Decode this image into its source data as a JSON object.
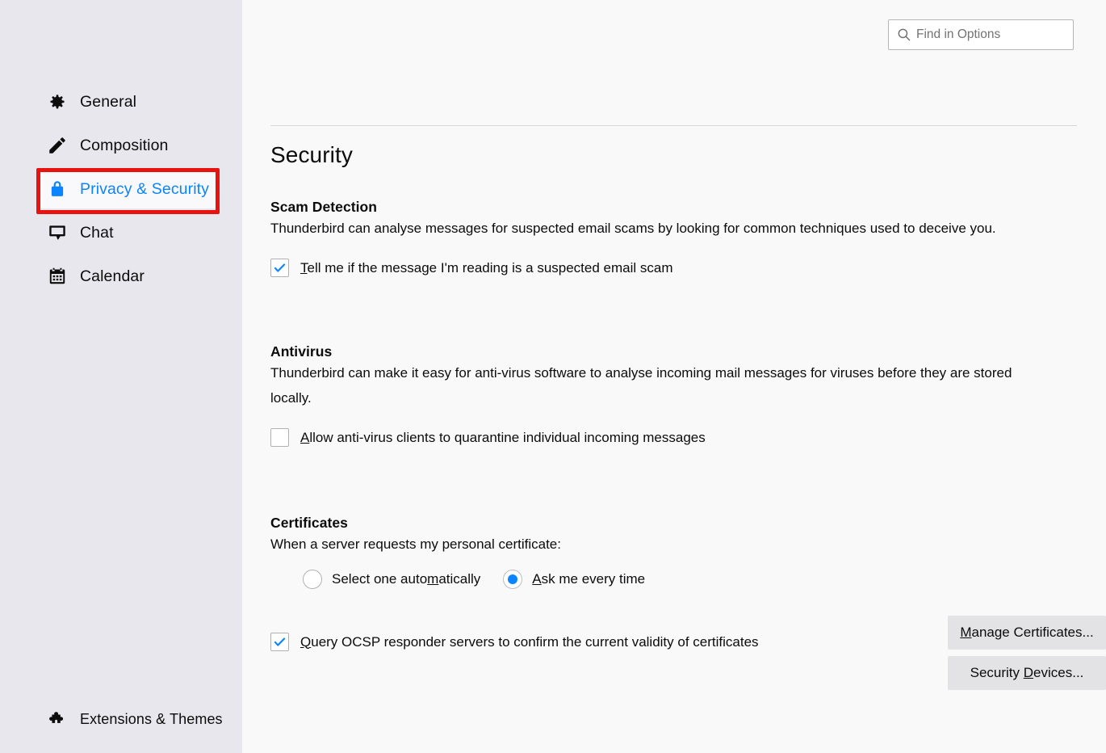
{
  "search": {
    "placeholder": "Find in Options",
    "value": "",
    "icon": "search-icon"
  },
  "sidebar": {
    "items": [
      {
        "id": "general",
        "label": "General",
        "icon": "gear-icon",
        "selected": false
      },
      {
        "id": "composition",
        "label": "Composition",
        "icon": "pencil-icon",
        "selected": false
      },
      {
        "id": "privacy",
        "label": "Privacy & Security",
        "icon": "lock-icon",
        "selected": true
      },
      {
        "id": "chat",
        "label": "Chat",
        "icon": "chat-bubble-icon",
        "selected": false
      },
      {
        "id": "calendar",
        "label": "Calendar",
        "icon": "calendar-icon",
        "selected": false
      }
    ],
    "footer": {
      "label": "Extensions & Themes",
      "icon": "puzzle-piece-icon"
    }
  },
  "page": {
    "title": "Security"
  },
  "sections": {
    "scam": {
      "title": "Scam Detection",
      "description": "Thunderbird can analyse messages for suspected email scams by looking for common techniques used to deceive you.",
      "checkbox": {
        "label_accesskey": "T",
        "label_rest": "ell me if the message I'm reading is a suspected email scam",
        "checked": true
      }
    },
    "antivirus": {
      "title": "Antivirus",
      "description": "Thunderbird can make it easy for anti-virus software to analyse incoming mail messages for viruses before they are stored locally.",
      "checkbox": {
        "label_accesskey": "A",
        "label_rest": "llow anti-virus clients to quarantine individual incoming messages",
        "checked": false
      }
    },
    "certificates": {
      "title": "Certificates",
      "description": "When a server requests my personal certificate:",
      "radios": [
        {
          "id": "select-auto",
          "before": "Select one auto",
          "accesskey": "m",
          "after": "atically",
          "selected": false
        },
        {
          "id": "ask-every-time",
          "before": "",
          "accesskey": "A",
          "after": "sk me every time",
          "selected": true
        }
      ],
      "ocsp_checkbox": {
        "label_accesskey": "Q",
        "label_rest": "uery OCSP responder servers to confirm the current validity of certificates",
        "checked": true
      },
      "buttons": [
        {
          "id": "manage-certificates",
          "before": "",
          "accesskey": "M",
          "after": "anage Certificates...",
          "highlighted": true
        },
        {
          "id": "security-devices",
          "before": "Security ",
          "accesskey": "D",
          "after": "evices...",
          "highlighted": false
        }
      ]
    }
  },
  "highlights": {
    "color": "#e8130f",
    "targets": [
      "sidebar-item-privacy",
      "manage-certificates-button"
    ]
  },
  "colors": {
    "accent": "#0a84ff",
    "sidebar_bg": "#e7e7ed",
    "main_bg": "#f9f9fa",
    "text": "#0c0c0d",
    "button_bg": "#e3e3e5",
    "highlight_red": "#e8130f"
  }
}
